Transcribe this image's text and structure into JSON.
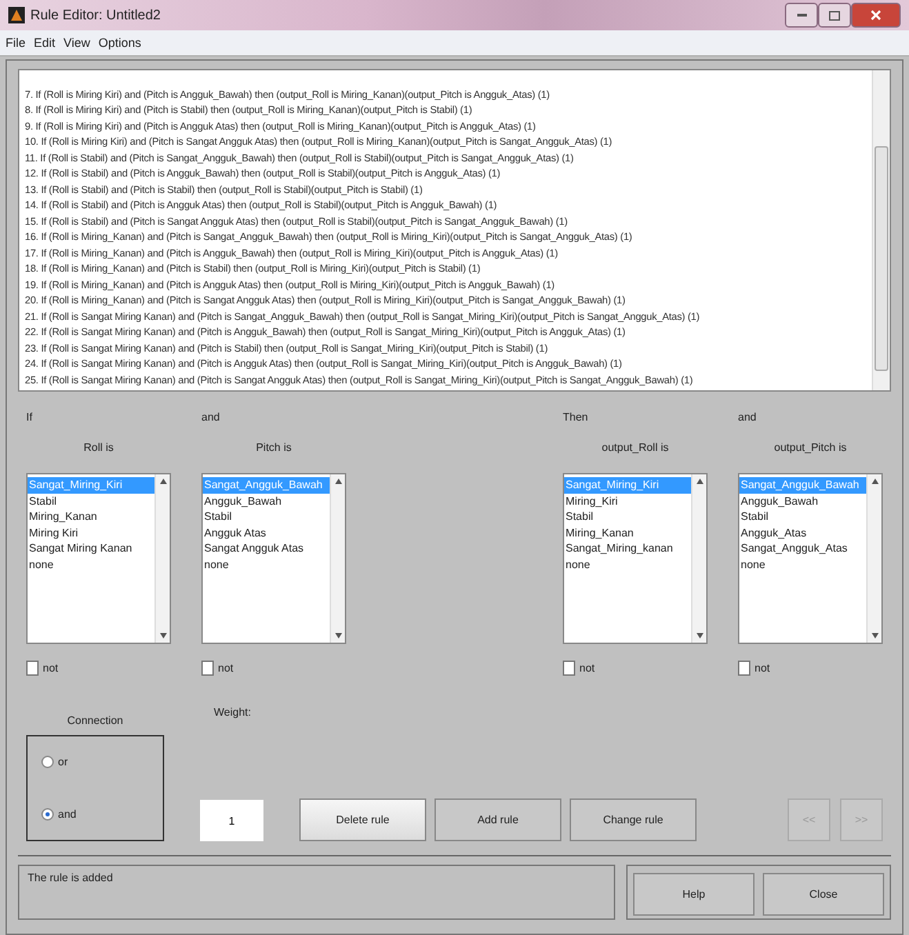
{
  "window": {
    "title": "Rule Editor: Untitled2"
  },
  "menu": [
    "File",
    "Edit",
    "View",
    "Options"
  ],
  "rules": [
    "7. If (Roll is Miring Kiri) and (Pitch is Angguk_Bawah) then (output_Roll is Miring_Kanan)(output_Pitch is Angguk_Atas) (1)",
    "8. If (Roll is Miring Kiri) and (Pitch is Stabil) then (output_Roll is Miring_Kanan)(output_Pitch is Stabil) (1)",
    "9. If (Roll is Miring Kiri) and (Pitch is Angguk Atas) then (output_Roll is Miring_Kanan)(output_Pitch is Angguk_Atas) (1)",
    "10. If (Roll is Miring Kiri) and (Pitch is Sangat Angguk Atas) then (output_Roll is Miring_Kanan)(output_Pitch is Sangat_Angguk_Atas) (1)",
    "11. If (Roll is Stabil) and (Pitch is Sangat_Angguk_Bawah) then (output_Roll is Stabil)(output_Pitch is Sangat_Angguk_Atas) (1)",
    "12. If (Roll is Stabil) and (Pitch is Angguk_Bawah) then (output_Roll is Stabil)(output_Pitch is Angguk_Atas) (1)",
    "13. If (Roll is Stabil) and (Pitch is Stabil) then (output_Roll is Stabil)(output_Pitch is Stabil) (1)",
    "14. If (Roll is Stabil) and (Pitch is Angguk Atas) then (output_Roll is Stabil)(output_Pitch is Angguk_Bawah) (1)",
    "15. If (Roll is Stabil) and (Pitch is Sangat Angguk Atas) then (output_Roll is Stabil)(output_Pitch is Sangat_Angguk_Bawah) (1)",
    "16. If (Roll is Miring_Kanan) and (Pitch is Sangat_Angguk_Bawah) then (output_Roll is Miring_Kiri)(output_Pitch is Sangat_Angguk_Atas) (1)",
    "17. If (Roll is Miring_Kanan) and (Pitch is Angguk_Bawah) then (output_Roll is Miring_Kiri)(output_Pitch is Angguk_Atas) (1)",
    "18. If (Roll is Miring_Kanan) and (Pitch is Stabil) then (output_Roll is Miring_Kiri)(output_Pitch is Stabil) (1)",
    "19. If (Roll is Miring_Kanan) and (Pitch is Angguk Atas) then (output_Roll is Miring_Kiri)(output_Pitch is Angguk_Bawah) (1)",
    "20. If (Roll is Miring_Kanan) and (Pitch is Sangat Angguk Atas) then (output_Roll is Miring_Kiri)(output_Pitch is Sangat_Angguk_Bawah) (1)",
    "21. If (Roll is Sangat Miring Kanan) and (Pitch is Sangat_Angguk_Bawah) then (output_Roll is Sangat_Miring_Kiri)(output_Pitch is Sangat_Angguk_Atas) (1)",
    "22. If (Roll is Sangat Miring Kanan) and (Pitch is Angguk_Bawah) then (output_Roll is Sangat_Miring_Kiri)(output_Pitch is Angguk_Atas) (1)",
    "23. If (Roll is Sangat Miring Kanan) and (Pitch is Stabil) then (output_Roll is Sangat_Miring_Kiri)(output_Pitch is Stabil) (1)",
    "24. If (Roll is Sangat Miring Kanan) and (Pitch is Angguk Atas) then (output_Roll is Sangat_Miring_Kiri)(output_Pitch is Angguk_Bawah) (1)",
    "25. If (Roll is Sangat Miring Kanan) and (Pitch is Sangat Angguk Atas) then (output_Roll is Sangat_Miring_Kiri)(output_Pitch is Sangat_Angguk_Bawah) (1)"
  ],
  "antecedents": [
    {
      "connector": "If",
      "variable": "Roll is",
      "options": [
        {
          "label": "Sangat_Miring_Kiri",
          "selected": true
        },
        {
          "label": "Stabil",
          "selected": false
        },
        {
          "label": "Miring_Kanan",
          "selected": false
        },
        {
          "label": "Miring Kiri",
          "selected": false
        },
        {
          "label": "Sangat Miring Kanan",
          "selected": false
        },
        {
          "label": "none",
          "selected": false
        }
      ],
      "not": {
        "label": "not",
        "checked": false
      }
    },
    {
      "connector": "and",
      "variable": "Pitch is",
      "options": [
        {
          "label": "Sangat_Angguk_Bawah",
          "selected": true
        },
        {
          "label": "Angguk_Bawah",
          "selected": false
        },
        {
          "label": "Stabil",
          "selected": false
        },
        {
          "label": "Angguk Atas",
          "selected": false
        },
        {
          "label": "Sangat Angguk Atas",
          "selected": false
        },
        {
          "label": "none",
          "selected": false
        }
      ],
      "not": {
        "label": "not",
        "checked": false
      }
    }
  ],
  "consequents": [
    {
      "connector": "Then",
      "variable": "output_Roll is",
      "options": [
        {
          "label": "Sangat_Miring_Kiri",
          "selected": true
        },
        {
          "label": "Miring_Kiri",
          "selected": false
        },
        {
          "label": "Stabil",
          "selected": false
        },
        {
          "label": "Miring_Kanan",
          "selected": false
        },
        {
          "label": "Sangat_Miring_kanan",
          "selected": false
        },
        {
          "label": "none",
          "selected": false
        }
      ],
      "not": {
        "label": "not",
        "checked": false
      }
    },
    {
      "connector": "and",
      "variable": "output_Pitch is",
      "options": [
        {
          "label": "Sangat_Angguk_Bawah",
          "selected": true
        },
        {
          "label": "Angguk_Bawah",
          "selected": false
        },
        {
          "label": "Stabil",
          "selected": false
        },
        {
          "label": "Angguk_Atas",
          "selected": false
        },
        {
          "label": "Sangat_Angguk_Atas",
          "selected": false
        },
        {
          "label": "none",
          "selected": false
        }
      ],
      "not": {
        "label": "not",
        "checked": false
      }
    }
  ],
  "connection": {
    "title": "Connection",
    "options": [
      {
        "label": "or",
        "selected": false
      },
      {
        "label": "and",
        "selected": true
      }
    ]
  },
  "weight": {
    "label": "Weight:",
    "value": "1"
  },
  "buttons": [
    {
      "label": "Delete rule",
      "disabled": false
    },
    {
      "label": "Add rule",
      "disabled": false
    },
    {
      "label": "Change rule",
      "disabled": false
    }
  ],
  "nav_buttons": [
    {
      "label": "<<",
      "disabled": true
    },
    {
      "label": ">>",
      "disabled": true
    }
  ],
  "status": "The rule is added",
  "footer_buttons": [
    "Help",
    "Close"
  ]
}
